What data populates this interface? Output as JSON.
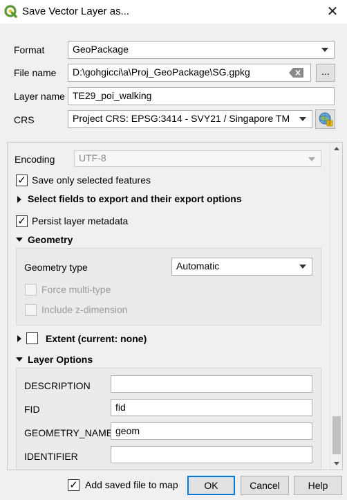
{
  "window": {
    "title": "Save Vector Layer as...",
    "app_icon": "qgis-logo-icon",
    "close_glyph": "✕"
  },
  "form": {
    "format_label": "Format",
    "format_value": "GeoPackage",
    "filename_label": "File name",
    "filename_value": "D:\\gohgicci\\a\\Proj_GeoPackage\\SG.gpkg",
    "browse_label": "...",
    "layername_label": "Layer name",
    "layername_value": "TE29_poi_walking",
    "crs_label": "CRS",
    "crs_value": "Project CRS: EPSG:3414 - SVY21 / Singapore TM"
  },
  "options": {
    "encoding_label": "Encoding",
    "encoding_value": "UTF-8",
    "save_selected_label": "Save only selected features",
    "save_selected_checked": true,
    "select_fields_label": "Select fields to export and their export options",
    "persist_metadata_label": "Persist layer metadata",
    "persist_metadata_checked": true,
    "geometry_section": "Geometry",
    "geometry_type_label": "Geometry type",
    "geometry_type_value": "Automatic",
    "force_multi_label": "Force multi-type",
    "include_z_label": "Include z-dimension",
    "extent_label": "Extent (current: none)",
    "layer_options_section": "Layer Options",
    "layer_options": [
      {
        "name": "DESCRIPTION",
        "value": ""
      },
      {
        "name": "FID",
        "value": "fid"
      },
      {
        "name": "GEOMETRY_NAME",
        "value": "geom"
      },
      {
        "name": "IDENTIFIER",
        "value": ""
      }
    ]
  },
  "footer": {
    "add_to_map_label": "Add saved file to map",
    "add_to_map_checked": true,
    "ok_label": "OK",
    "cancel_label": "Cancel",
    "help_label": "Help"
  },
  "colors": {
    "accent": "#0078d7",
    "qgis_green": "#589632",
    "qgis_yellow": "#f0c000"
  }
}
